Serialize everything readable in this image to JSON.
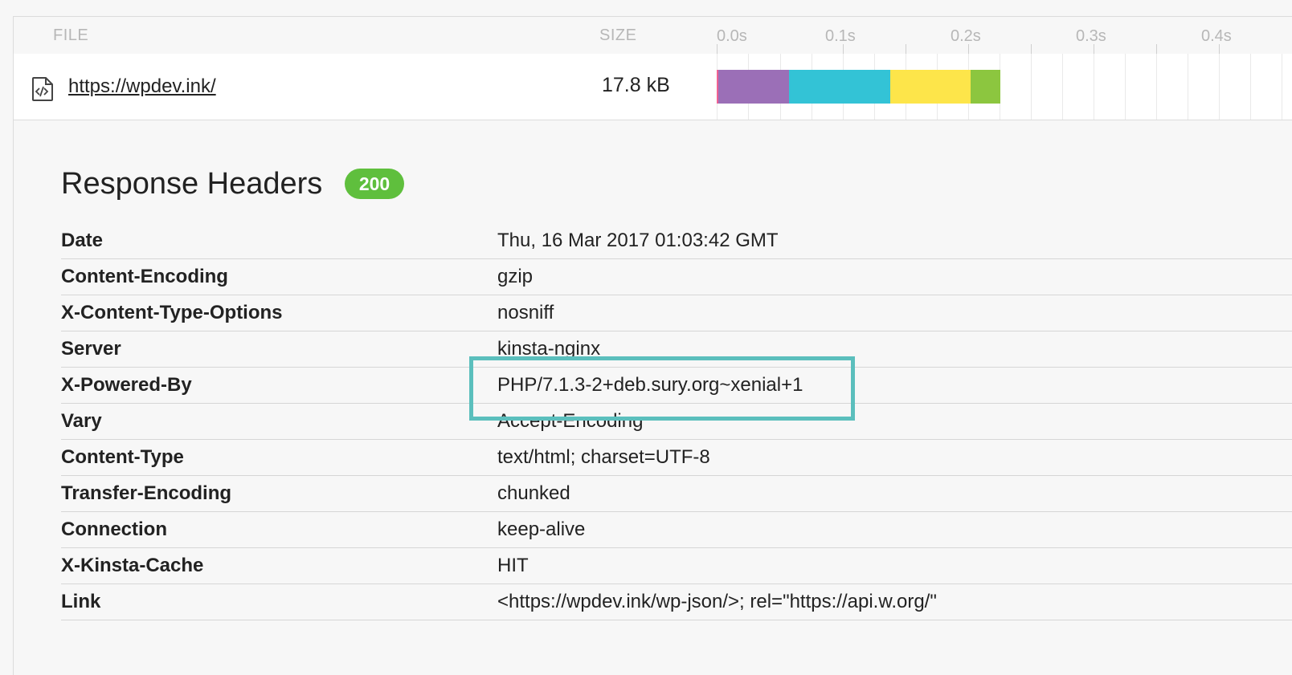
{
  "table_header": {
    "file_label": "FILE",
    "size_label": "SIZE",
    "timeline_ticks": [
      "0.0s",
      "0.1s",
      "0.2s",
      "0.3s",
      "0.4s"
    ]
  },
  "request": {
    "url": "https://wpdev.ink/",
    "size": "17.8 kB",
    "icon": "html-file-icon",
    "timing_segments": [
      {
        "phase": "dns",
        "color": "#f06292"
      },
      {
        "phase": "connect",
        "color": "#9b6fb7"
      },
      {
        "phase": "send-wait",
        "color": "#33c3d6"
      },
      {
        "phase": "receive-start",
        "color": "#fde54a"
      },
      {
        "phase": "receive-end",
        "color": "#8cc63f"
      }
    ]
  },
  "response": {
    "title": "Response Headers",
    "status": "200",
    "status_color": "#5fbf3d",
    "headers": [
      {
        "name": "Date",
        "value": "Thu, 16 Mar 2017 01:03:42 GMT"
      },
      {
        "name": "Content-Encoding",
        "value": "gzip"
      },
      {
        "name": "X-Content-Type-Options",
        "value": "nosniff"
      },
      {
        "name": "Server",
        "value": "kinsta-nginx"
      },
      {
        "name": "X-Powered-By",
        "value": "PHP/7.1.3-2+deb.sury.org~xenial+1"
      },
      {
        "name": "Vary",
        "value": "Accept-Encoding"
      },
      {
        "name": "Content-Type",
        "value": "text/html; charset=UTF-8"
      },
      {
        "name": "Transfer-Encoding",
        "value": "chunked"
      },
      {
        "name": "Connection",
        "value": "keep-alive"
      },
      {
        "name": "X-Kinsta-Cache",
        "value": "HIT"
      },
      {
        "name": "Link",
        "value": "<https://wpdev.ink/wp-json/>; rel=\"https://api.w.org/\""
      }
    ],
    "highlight_color": "#5bbfbd"
  }
}
